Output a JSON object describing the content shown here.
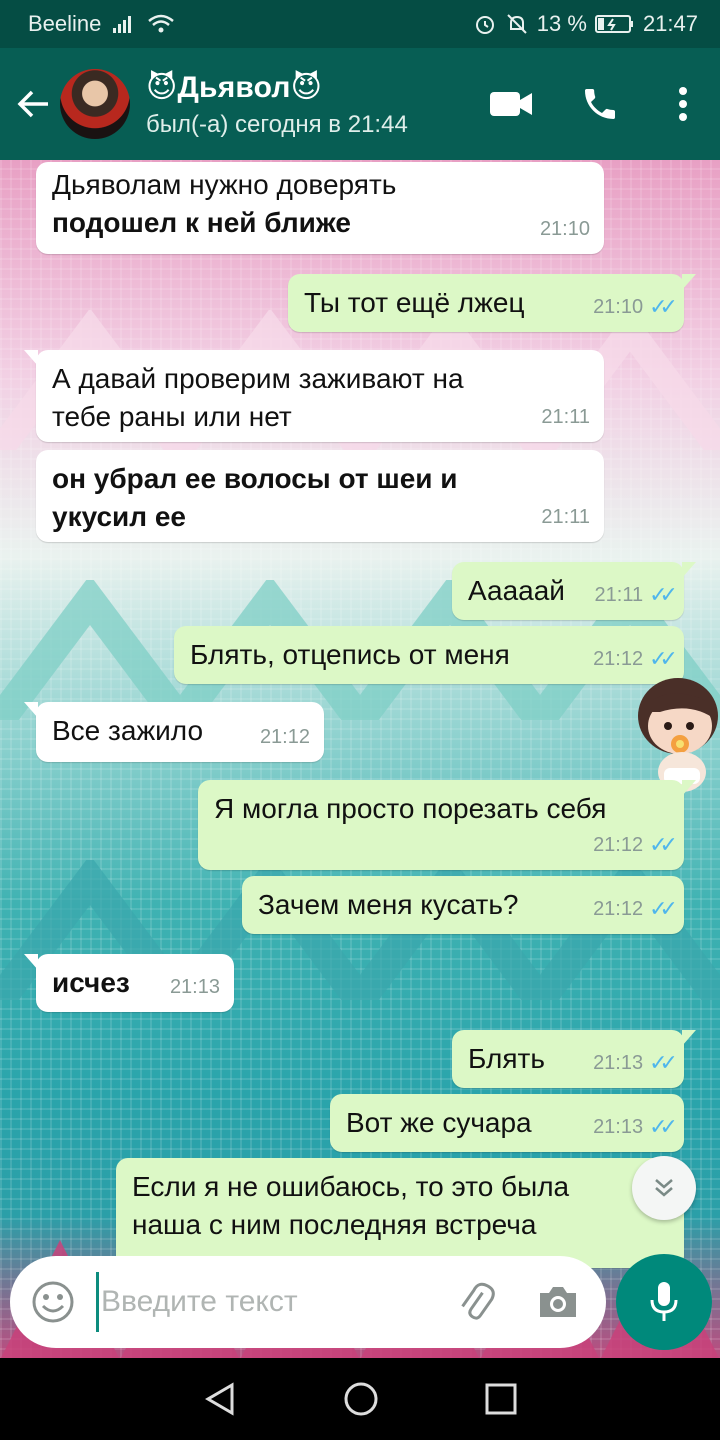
{
  "status_bar": {
    "carrier": "Beeline",
    "battery": "13 %",
    "time": "21:47"
  },
  "header": {
    "contact_name": "😈Дьявол😈",
    "last_seen": "был(-а) сегодня в 21:44"
  },
  "messages": [
    {
      "dir": "in",
      "lines": [
        "Дьяволам нужно доверять",
        "**подошел к ней ближе"
      ],
      "time": "21:10"
    },
    {
      "dir": "out",
      "text": "Ты тот ещё лжец",
      "time": "21:10"
    },
    {
      "dir": "in",
      "lines": [
        "А давай проверим заживают на",
        "тебе раны или нет"
      ],
      "time": "21:11"
    },
    {
      "dir": "in",
      "bold_lines": [
        "он убрал ее волосы от шеи и",
        "укусил ее"
      ],
      "time": "21:11"
    },
    {
      "dir": "out",
      "text": "Ааааай",
      "time": "21:11"
    },
    {
      "dir": "out",
      "text": "Блять, отцепись от меня",
      "time": "21:12"
    },
    {
      "dir": "in",
      "text": "Все зажило",
      "time": "21:12"
    },
    {
      "dir": "out",
      "text": "Я могла просто порезать себя",
      "time": "21:12"
    },
    {
      "dir": "out",
      "text": "Зачем меня кусать?",
      "time": "21:12"
    },
    {
      "dir": "in",
      "bold_text": "исчез",
      "time": "21:13"
    },
    {
      "dir": "out",
      "text": "Блять",
      "time": "21:13"
    },
    {
      "dir": "out",
      "text": "Вот же сучара",
      "time": "21:13"
    },
    {
      "dir": "out",
      "lines": [
        "Если я не ошибаюсь, то это была",
        "наша с ним последняя встреча"
      ],
      "time": ""
    }
  ],
  "m": {
    "m0_l1": "Дьяволам нужно доверять",
    "m0_l2": "подошел к ней ближе",
    "m0_t": "21:10",
    "m1_text": "Ты тот ещё лжец",
    "m1_t": "21:10",
    "m2_l1": "А давай проверим заживают на",
    "m2_l2": "тебе раны или нет",
    "m2_t": "21:11",
    "m3_l1": "он убрал ее волосы от шеи и",
    "m3_l2": "укусил ее",
    "m3_t": "21:11",
    "m4_text": "Ааааай",
    "m4_t": "21:11",
    "m5_text": "Блять, отцепись от меня",
    "m5_t": "21:12",
    "m6_text": "Все зажило",
    "m6_t": "21:12",
    "m7_text": "Я могла просто порезать себя",
    "m7_t": "21:12",
    "m8_text": "Зачем меня кусать?",
    "m8_t": "21:12",
    "m9_text": "исчез",
    "m9_t": "21:13",
    "m10_text": "Блять",
    "m10_t": "21:13",
    "m11_text": "Вот же сучара",
    "m11_t": "21:13",
    "m12_l1": "Если я не ошибаюсь, то это была",
    "m12_l2": "наша с ним последняя встреча"
  },
  "composer": {
    "placeholder": "Введите текст"
  },
  "colors": {
    "header": "#075e54",
    "status_bar": "#054d44",
    "outgoing_bubble": "#dcf8c6",
    "incoming_bubble": "#ffffff",
    "read_ticks": "#4fb6ec",
    "mic_button": "#00897b"
  },
  "icons": [
    "back-arrow-icon",
    "video-call-icon",
    "phone-icon",
    "more-vert-icon",
    "emoji-icon",
    "attach-icon",
    "camera-icon",
    "mic-icon",
    "scroll-down-icon",
    "nav-back-icon",
    "nav-home-icon",
    "nav-recents-icon"
  ]
}
